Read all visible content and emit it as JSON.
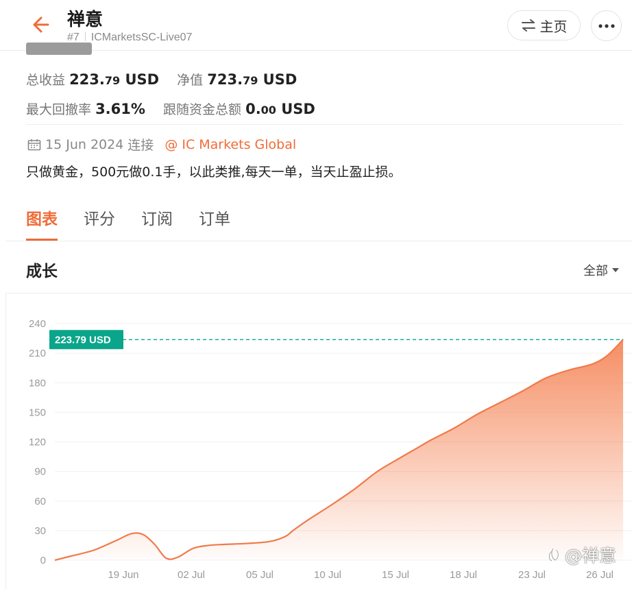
{
  "header": {
    "title": "禅意",
    "account_number": "#7",
    "server": "ICMarketsSC-Live07",
    "home_label": "主页"
  },
  "stats": {
    "total_profit_label": "总收益",
    "total_profit_value": "223.",
    "total_profit_decimals": "79",
    "total_profit_unit": "USD",
    "net_value_label": "净值",
    "net_value_value": "723.",
    "net_value_decimals": "79",
    "net_value_unit": "USD",
    "max_drawdown_label": "最大回撤率",
    "max_drawdown_value": "3.61%",
    "follow_funds_label": "跟随资金总额",
    "follow_funds_value": "0.",
    "follow_funds_decimals": "00",
    "follow_funds_unit": "USD"
  },
  "connection": {
    "date": "15 Jun 2024",
    "status": "连接",
    "broker": "@ IC Markets Global"
  },
  "description": "只做黄金，500元做0.1手，以此类推,每天一单，当天止盈止损。",
  "tabs": [
    {
      "label": "图表",
      "active": true
    },
    {
      "label": "评分",
      "active": false
    },
    {
      "label": "订阅",
      "active": false
    },
    {
      "label": "订单",
      "active": false
    }
  ],
  "section": {
    "title": "成长",
    "filter_label": "全部"
  },
  "watermark": "@禅意",
  "colors": {
    "accent": "#f06b38",
    "current_value_tag": "#0aa58a",
    "line": "#f07a4a"
  },
  "chart_data": {
    "type": "area",
    "title": "",
    "xlabel": "",
    "ylabel": "",
    "ylim": [
      0,
      240
    ],
    "yticks": [
      0,
      30,
      60,
      90,
      120,
      150,
      180,
      210,
      240
    ],
    "xtick_labels": [
      "19 Jun",
      "02 Jul",
      "05 Jul",
      "10 Jul",
      "15 Jul",
      "18 Jul",
      "23 Jul",
      "26 Jul"
    ],
    "current_value_label": "223.79 USD",
    "current_value": 223.79,
    "grid": true,
    "series": [
      {
        "x": [
          0,
          0.05,
          0.2,
          0.5,
          0.8,
          1.0,
          1.15,
          1.3,
          1.45,
          1.6,
          1.8,
          2.0,
          2.2,
          2.5,
          2.8,
          3.0,
          3.1,
          3.3,
          3.6,
          3.9,
          4.2,
          4.5,
          4.7,
          4.9,
          5.2,
          5.5,
          5.8,
          6.1,
          6.4,
          6.7,
          7.0,
          7.2,
          7.4
        ],
        "y": [
          0,
          1,
          4,
          10,
          20,
          27,
          26,
          16,
          2,
          3,
          12,
          15,
          16,
          17,
          19,
          24,
          30,
          41,
          56,
          72,
          90,
          104,
          113,
          122,
          134,
          148,
          160,
          172,
          185,
          193,
          199,
          208,
          224
        ]
      }
    ]
  }
}
